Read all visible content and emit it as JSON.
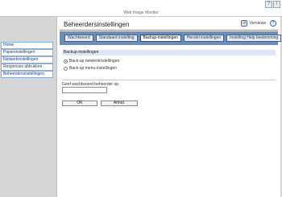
{
  "app": {
    "header_title": "Web Image Monitor",
    "top_buttons": [
      "?",
      "i"
    ]
  },
  "sidebar": {
    "items": [
      {
        "label": "Home"
      },
      {
        "label": "Papierinstellingen"
      },
      {
        "label": "Netwerkinstellingen"
      },
      {
        "label": "Responses afdrukken"
      },
      {
        "label": "Beheerdersinstellingen"
      }
    ]
  },
  "main": {
    "title": "Beheerdersinstellingen",
    "refresh_label": "Vernieuw",
    "help_symbol": "?",
    "tabs": [
      {
        "label": "Wachtwoord",
        "active": false
      },
      {
        "label": "Standaard instelling",
        "active": false
      },
      {
        "label": "Backup-instellingen",
        "active": true
      },
      {
        "label": "Herstel instellingen",
        "active": false
      },
      {
        "label": "Instelling Help bestemming",
        "active": false
      }
    ],
    "section_title": "Backup-instellingen",
    "radios": [
      {
        "label": "Back-up netwerkinstellingen",
        "checked": true
      },
      {
        "label": "Back-up menu-instellingen",
        "checked": false
      }
    ],
    "password_label": "Geef wachtwoord beheerder op",
    "password_value": "",
    "ok_label": "OK",
    "cancel_label": "Annul."
  }
}
